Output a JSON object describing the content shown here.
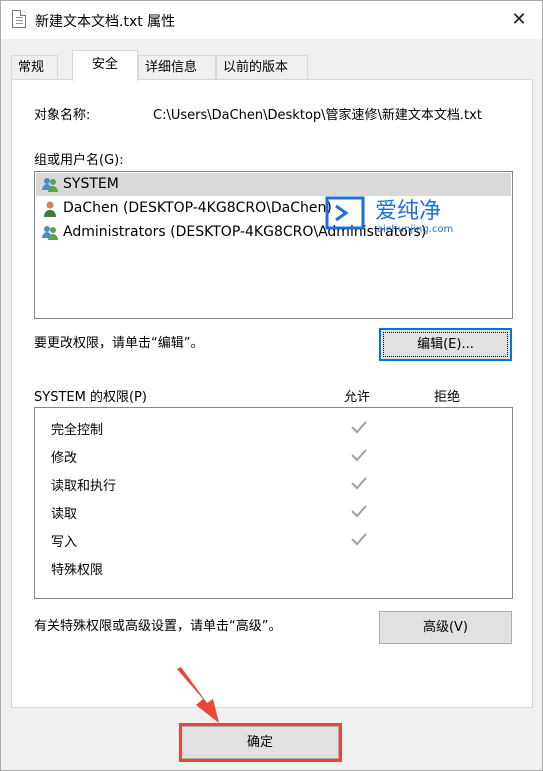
{
  "window": {
    "title": "新建文本文档.txt 属性",
    "close_glyph": "✕"
  },
  "tabs": [
    {
      "label": "常规",
      "active": false
    },
    {
      "label": "安全",
      "active": true
    },
    {
      "label": "详细信息",
      "active": false
    },
    {
      "label": "以前的版本",
      "active": false
    }
  ],
  "security": {
    "object_name_label": "对象名称:",
    "object_name_value": "C:\\Users\\DaChen\\Desktop\\管家速修\\新建文本文档.txt",
    "groups_label": "组或用户名(G):",
    "users": [
      {
        "name": "SYSTEM",
        "selected": true,
        "icon": "user-group-icon"
      },
      {
        "name": "DaChen (DESKTOP-4KG8CRO\\DaChen)",
        "selected": false,
        "icon": "user-icon"
      },
      {
        "name": "Administrators (DESKTOP-4KG8CRO\\Administrators)",
        "selected": false,
        "icon": "user-group-icon"
      }
    ],
    "change_perm_hint": "要更改权限，请单击“编辑”。",
    "edit_button": "编辑(E)...",
    "perm_header": "SYSTEM 的权限(P)",
    "allow_header": "允许",
    "deny_header": "拒绝",
    "permissions": [
      {
        "name": "完全控制",
        "allow": true,
        "deny": false
      },
      {
        "name": "修改",
        "allow": true,
        "deny": false
      },
      {
        "name": "读取和执行",
        "allow": true,
        "deny": false
      },
      {
        "name": "读取",
        "allow": true,
        "deny": false
      },
      {
        "name": "写入",
        "allow": true,
        "deny": false
      },
      {
        "name": "特殊权限",
        "allow": false,
        "deny": false
      }
    ],
    "advanced_hint": "有关特殊权限或高级设置，请单击“高级”。",
    "advanced_button": "高级(V)"
  },
  "footer": {
    "ok_button": "确定"
  },
  "watermark": {
    "brand": "爱纯净",
    "url": "aichunjing.com"
  },
  "colors": {
    "selection": "#d9d9d9",
    "focus_border": "#0078d7",
    "check_gray": "#a0a0a0",
    "annotation_red": "#e8453c",
    "watermark_blue": "#1e6fd9"
  }
}
